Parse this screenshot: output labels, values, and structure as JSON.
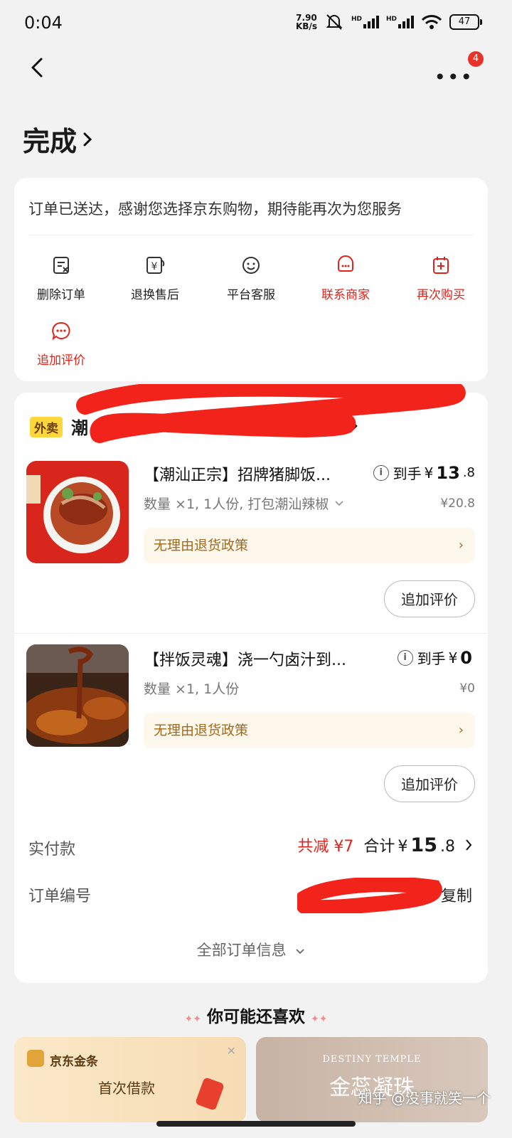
{
  "status_bar": {
    "time": "0:04",
    "net_speed_value": "7.90",
    "net_speed_unit": "KB/s",
    "signal1_label": "HD",
    "signal2_label": "HD",
    "battery": "47"
  },
  "nav": {
    "back_icon": "chevron-left-icon",
    "more_icon": "more-dots-icon",
    "more_badge": "4"
  },
  "order_status": {
    "title": "完成"
  },
  "status_card": {
    "message": "订单已送达，感谢您选择京东购物，期待能再次为您服务",
    "actions": [
      {
        "label": "删除订单",
        "icon": "delete-order-icon",
        "highlight": false
      },
      {
        "label": "退换售后",
        "icon": "return-exchange-icon",
        "highlight": false
      },
      {
        "label": "平台客服",
        "icon": "customer-service-icon",
        "highlight": false
      },
      {
        "label": "联系商家",
        "icon": "contact-merchant-icon",
        "highlight": true
      },
      {
        "label": "再次购买",
        "icon": "buy-again-icon",
        "highlight": true
      },
      {
        "label": "追加评价",
        "icon": "add-review-icon",
        "highlight": true
      }
    ]
  },
  "shop": {
    "tag": "外卖",
    "name_visible": "潮"
  },
  "items": [
    {
      "name": "【潮汕正宗】招牌猪脚饭...",
      "spec": "数量 ×1, 1人份, 打包潮汕辣椒",
      "price_prefix": "到手",
      "price_symbol": "¥",
      "price_int": "13",
      "price_dec": ".8",
      "orig_price": "¥20.8",
      "policy": "无理由退货政策",
      "review_button": "追加评价"
    },
    {
      "name": "【拌饭灵魂】浇一勺卤汁到...",
      "spec": "数量 ×1, 1人份",
      "price_prefix": "到手",
      "price_symbol": "¥",
      "price_int": "0",
      "price_dec": "",
      "orig_price": "¥0",
      "policy": "无理由退货政策",
      "review_button": "追加评价"
    }
  ],
  "payment": {
    "label": "实付款",
    "discount": "共减 ¥7",
    "total_prefix": "合计",
    "total_symbol": "¥",
    "total_int": "15",
    "total_dec": ".8"
  },
  "order_number": {
    "label": "订单编号",
    "copy": "复制"
  },
  "all_order_info": "全部订单信息",
  "recommend": {
    "title": "你可能还喜欢",
    "card1_brand": "京东金条",
    "card1_text": "首次借款",
    "card2_en": "DESTINY TEMPLE",
    "card2_cn": "金蕊凝珠"
  },
  "watermark": "知乎 @没事就笑一个",
  "colors": {
    "accent_red": "#e2231a",
    "tag_yellow": "#ffd63b",
    "policy_bg": "#fdf7ec",
    "policy_text": "#a26a1a"
  }
}
